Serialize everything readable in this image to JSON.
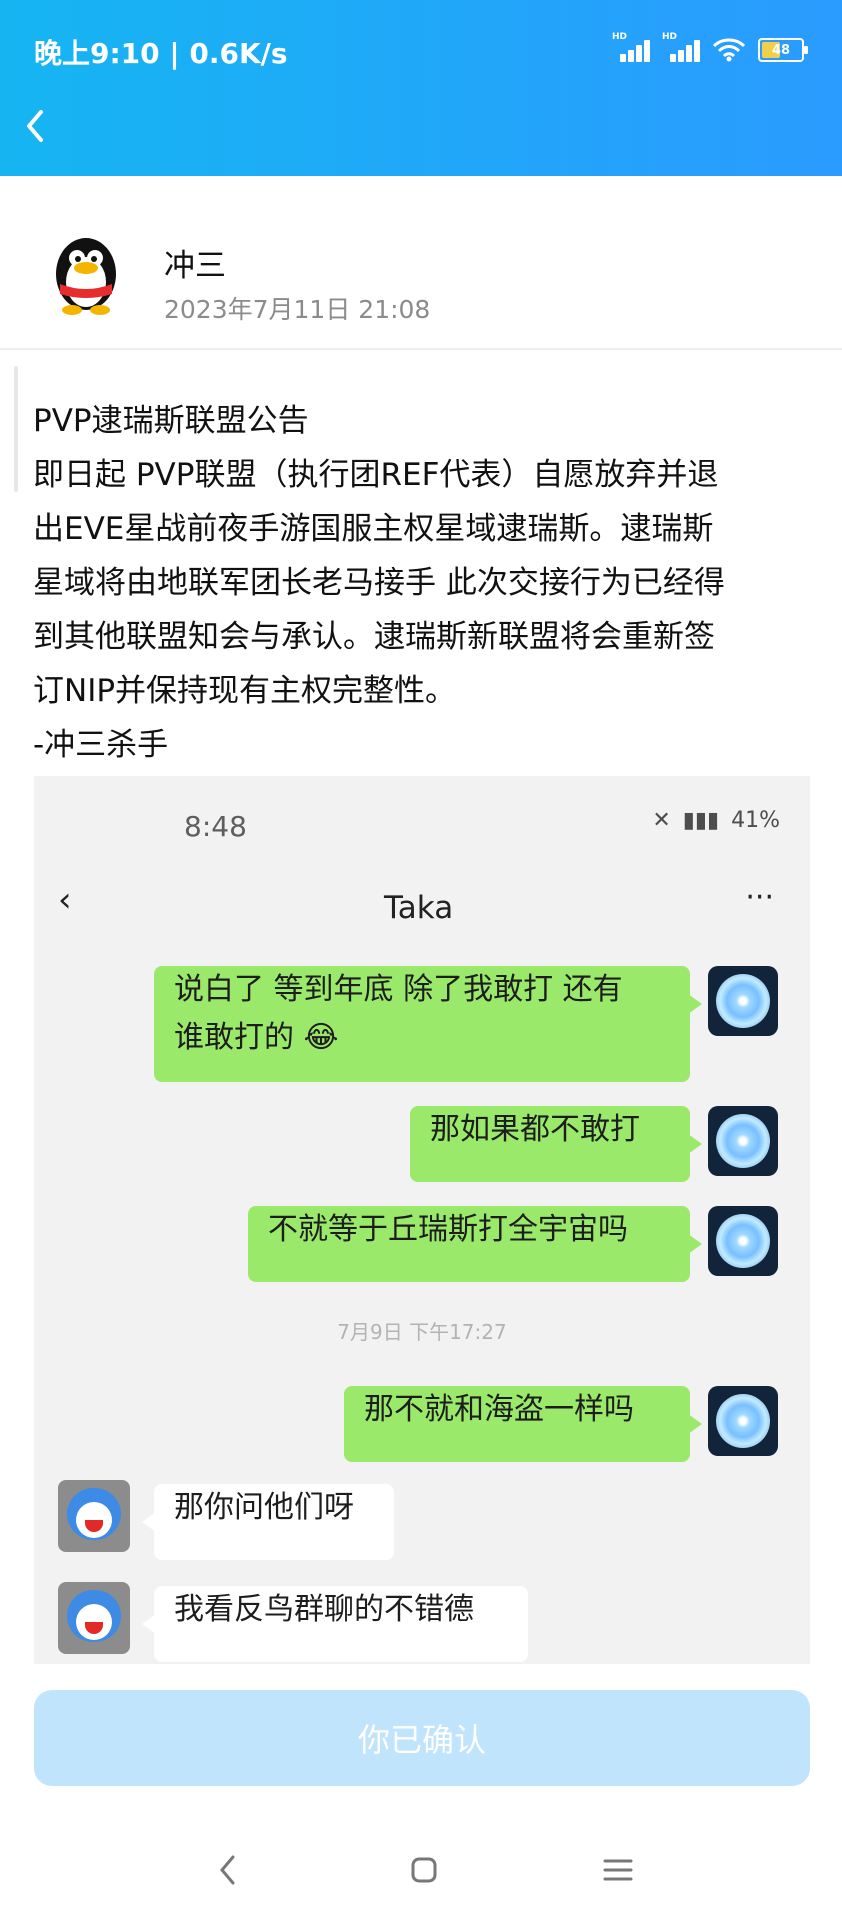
{
  "status_bar": {
    "time": "晚上9:10 | 0.6K/s",
    "battery": "48"
  },
  "post": {
    "author": "冲三",
    "timestamp": "2023年7月11日 21:08",
    "lines": [
      "PVP逮瑞斯联盟公告",
      "即日起 PVP联盟（执行团REF代表）自愿放弃并退",
      "出EVE星战前夜手游国服主权星域逮瑞斯。逮瑞斯",
      "星域将由地联军团长老马接手 此次交接行为已经得",
      "到其他联盟知会与承认。逮瑞斯新联盟将会重新签",
      "订NIP并保持现有主权完整性。",
      "-冲三杀手"
    ]
  },
  "embedded_chat": {
    "status_time": "8:48",
    "status_battery": "41%",
    "title": "Taka",
    "messages": [
      "说白了 等到年底 除了我敢打 还有",
      "谁敢打的 😂",
      "那如果都不敢打",
      "不就等于丘瑞斯打全宇宙吗",
      "7月9日 下午17:27",
      "那不就和海盗一样吗",
      "那你问他们呀",
      "我看反鸟群聊的不错德"
    ]
  },
  "confirm_button": "你已确认",
  "colors": {
    "header_blue": "#1da8f7",
    "confirm_bg": "#bfe4fb",
    "chat_green": "#9be96b"
  }
}
